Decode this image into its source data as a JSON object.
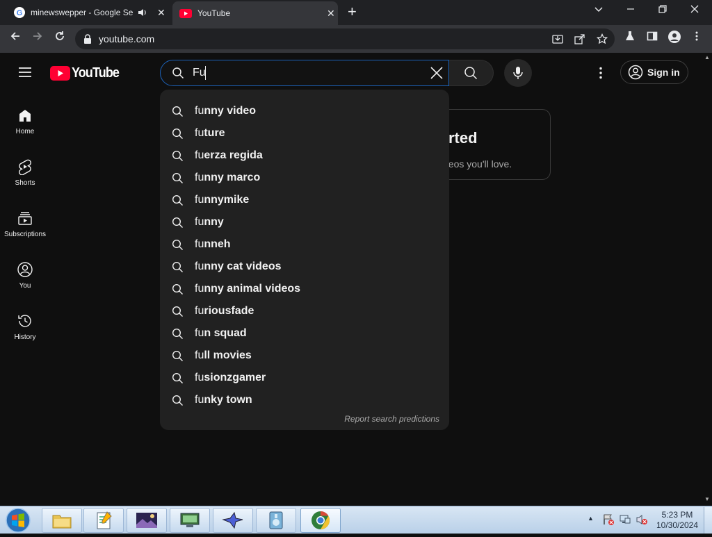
{
  "browser": {
    "tabs": [
      {
        "title": "minewswepper - Google Se",
        "favicon": "google-icon",
        "active": false,
        "audio": true
      },
      {
        "title": "YouTube",
        "favicon": "youtube-icon",
        "active": true
      }
    ],
    "url": "youtube.com"
  },
  "youtube": {
    "logo_text": "YouTube",
    "search_value": "Fu",
    "sign_in_label": "Sign in",
    "sidebar": [
      {
        "label": "Home",
        "icon": "home-icon"
      },
      {
        "label": "Shorts",
        "icon": "shorts-icon"
      },
      {
        "label": "Subscriptions",
        "icon": "subscriptions-icon"
      },
      {
        "label": "You",
        "icon": "you-icon"
      },
      {
        "label": "History",
        "icon": "history-icon"
      }
    ],
    "suggestions": [
      {
        "prefix": "fu",
        "rest": "nny video"
      },
      {
        "prefix": "fu",
        "rest": "ture"
      },
      {
        "prefix": "fu",
        "rest": "erza regida"
      },
      {
        "prefix": "fu",
        "rest": "nny marco"
      },
      {
        "prefix": "fu",
        "rest": "nnymike"
      },
      {
        "prefix": "fu",
        "rest": "nny"
      },
      {
        "prefix": "fu",
        "rest": "nneh"
      },
      {
        "prefix": "fu",
        "rest": "nny cat videos"
      },
      {
        "prefix": "fu",
        "rest": "nny animal videos"
      },
      {
        "prefix": "fu",
        "rest": "riousfade"
      },
      {
        "prefix": "fu",
        "rest": "n squad"
      },
      {
        "prefix": "fu",
        "rest": "ll movies"
      },
      {
        "prefix": "fu",
        "rest": "sionzgamer"
      },
      {
        "prefix": "fu",
        "rest": "nky town"
      }
    ],
    "report_label": "Report search predictions",
    "background_card": {
      "title_fragment": "rted",
      "subtitle_fragment": "deos you'll love."
    }
  },
  "taskbar": {
    "time": "5:23 PM",
    "date": "10/30/2024",
    "apps": [
      "file-explorer-icon",
      "notepad-icon",
      "photo-viewer-icon",
      "network-icon",
      "bird-app-icon",
      "media-player-icon",
      "chrome-icon"
    ]
  },
  "colors": {
    "accent_red": "#ff0033",
    "search_border": "#1c62b9",
    "dropdown_bg": "#212121"
  }
}
